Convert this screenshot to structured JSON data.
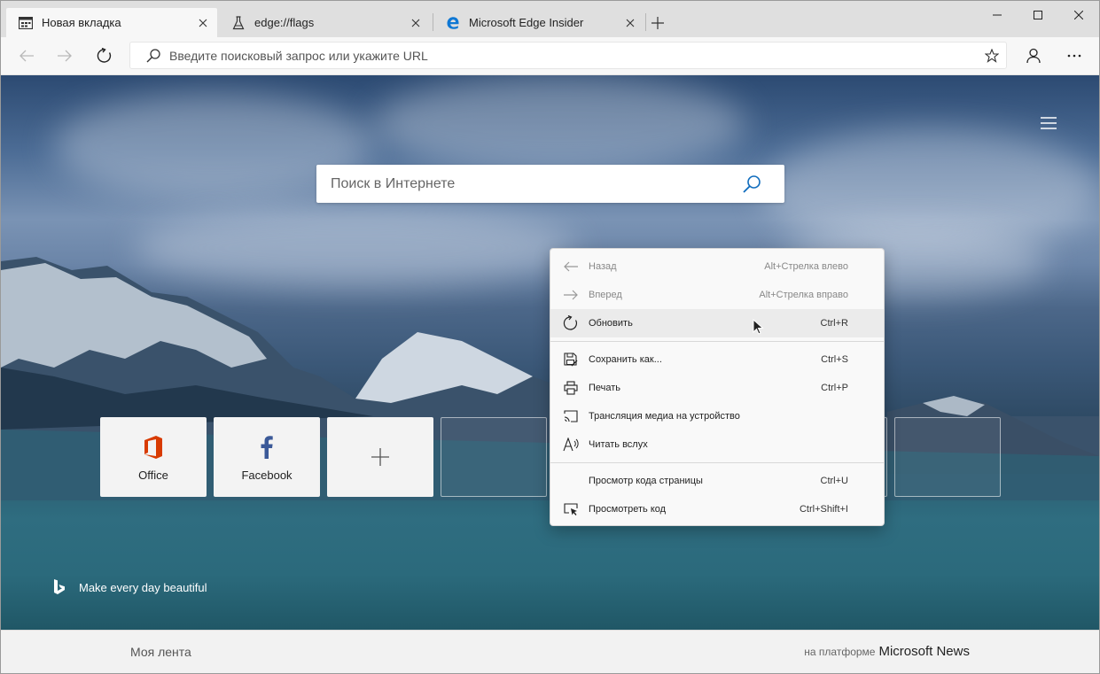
{
  "tabs": [
    {
      "title": "Новая вкладка",
      "icon": "newtab-page-icon",
      "active": true
    },
    {
      "title": "edge://flags",
      "icon": "flask-icon",
      "active": false
    },
    {
      "title": "Microsoft Edge Insider",
      "icon": "edge-logo-icon",
      "active": false
    }
  ],
  "address_bar": {
    "placeholder": "Введите поисковый запрос или укажите URL",
    "value": ""
  },
  "web_search": {
    "placeholder": "Поиск в Интернете"
  },
  "tiles": [
    {
      "label": "Office",
      "icon": "office-icon"
    },
    {
      "label": "Facebook",
      "icon": "facebook-icon"
    },
    {
      "label": "",
      "icon": "plus-icon"
    }
  ],
  "bing": {
    "text": "Make every day beautiful"
  },
  "feed": {
    "my_feed": "Моя лента",
    "powered_prefix": "на платформе",
    "powered_brand": "Microsoft News"
  },
  "context_menu": {
    "items": [
      {
        "label": "Назад",
        "shortcut": "Alt+Стрелка влево",
        "icon": "back-arrow-icon",
        "disabled": true
      },
      {
        "label": "Вперед",
        "shortcut": "Alt+Стрелка вправо",
        "icon": "forward-arrow-icon",
        "disabled": true
      },
      {
        "label": "Обновить",
        "shortcut": "Ctrl+R",
        "icon": "refresh-icon",
        "hover": true
      },
      {
        "label": "Сохранить как...",
        "shortcut": "Ctrl+S",
        "icon": "save-as-icon"
      },
      {
        "label": "Печать",
        "shortcut": "Ctrl+P",
        "icon": "print-icon"
      },
      {
        "label": "Трансляция медиа на устройство",
        "shortcut": "",
        "icon": "cast-icon"
      },
      {
        "label": "Читать вслух",
        "shortcut": "",
        "icon": "read-aloud-icon"
      },
      {
        "label": "Просмотр кода страницы",
        "shortcut": "Ctrl+U",
        "icon": ""
      },
      {
        "label": "Просмотреть код",
        "shortcut": "Ctrl+Shift+I",
        "icon": "inspect-icon"
      }
    ]
  },
  "colors": {
    "office_red": "#d83b01",
    "facebook_blue": "#3b5998",
    "edge_blue": "#0f78d4"
  }
}
